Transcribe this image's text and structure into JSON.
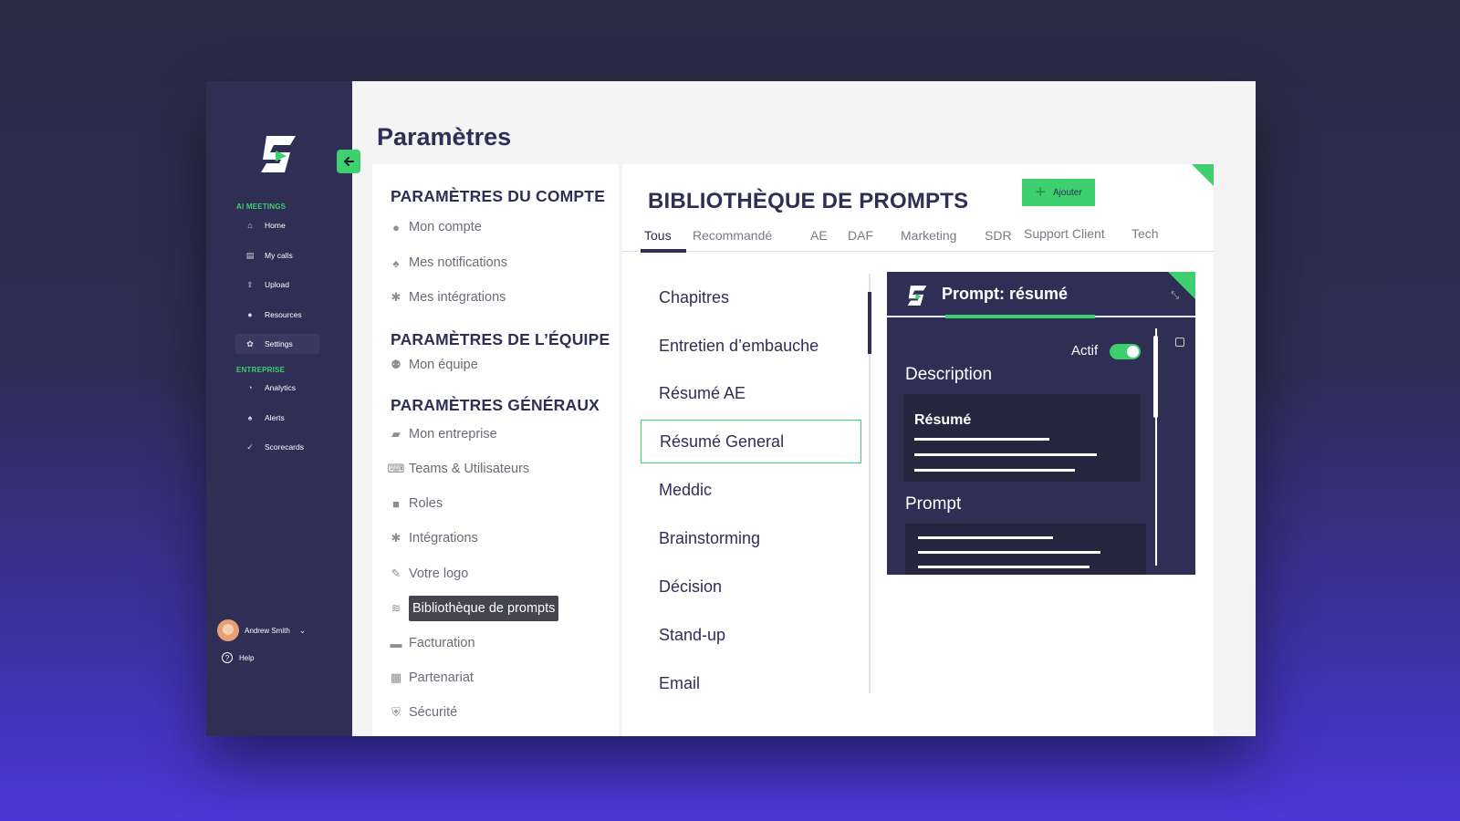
{
  "sidebar": {
    "section_ai": "AI MEETINGS",
    "section_ent": "ENTREPRISE",
    "items": [
      {
        "label": "Home",
        "icon": "home-icon"
      },
      {
        "label": "My calls",
        "icon": "calls-icon"
      },
      {
        "label": "Upload",
        "icon": "upload-icon"
      },
      {
        "label": "Resources",
        "icon": "resources-icon"
      },
      {
        "label": "Settings",
        "icon": "gear-icon"
      },
      {
        "label": "Analytics",
        "icon": "analytics-icon"
      },
      {
        "label": "Alerts",
        "icon": "bell-icon"
      },
      {
        "label": "Scorecards",
        "icon": "check-icon"
      }
    ],
    "user_name": "Andrew Smith",
    "help": "Help"
  },
  "page_title": "Paramètres",
  "settings": {
    "account_title": "PARAMÈTRES DU COMPTE",
    "account_items": [
      "Mon compte",
      "Mes notifications",
      "Mes intégrations"
    ],
    "team_title": "PARAMÈTRES DE L’ÉQUIPE",
    "team_items": [
      "Mon équipe"
    ],
    "general_title": "PARAMÈTRES GÉNÉRAUX",
    "general_items": [
      "Mon entreprise",
      "Teams & Utilisateurs",
      "Roles",
      "Intégrations",
      "Votre logo",
      "Bibliothèque de prompts",
      "Facturation",
      "Partenariat",
      "Sécurité"
    ]
  },
  "library": {
    "title": "BIBLIOTHÈQUE DE PROMPTS",
    "add_label": "Ajouter",
    "tabs": [
      "Tous",
      "Recommandé",
      "AE",
      "DAF",
      "Marketing",
      "SDR",
      "Support Client",
      "Tech"
    ],
    "active_tab": "Tous",
    "prompts": [
      "Chapitres",
      "Entretien d’embauche",
      "Résumé AE",
      "Résumé General",
      "Meddic",
      "Brainstorming",
      "Décision",
      "Stand-up",
      "Email"
    ],
    "selected_prompt": "Résumé General"
  },
  "detail": {
    "title": "Prompt: résumé",
    "active_label": "Actif",
    "active": true,
    "description_label": "Description",
    "description_card_title": "Résumé",
    "prompt_label": "Prompt"
  },
  "colors": {
    "accent": "#3ecf6e",
    "navy": "#2f2e55"
  }
}
